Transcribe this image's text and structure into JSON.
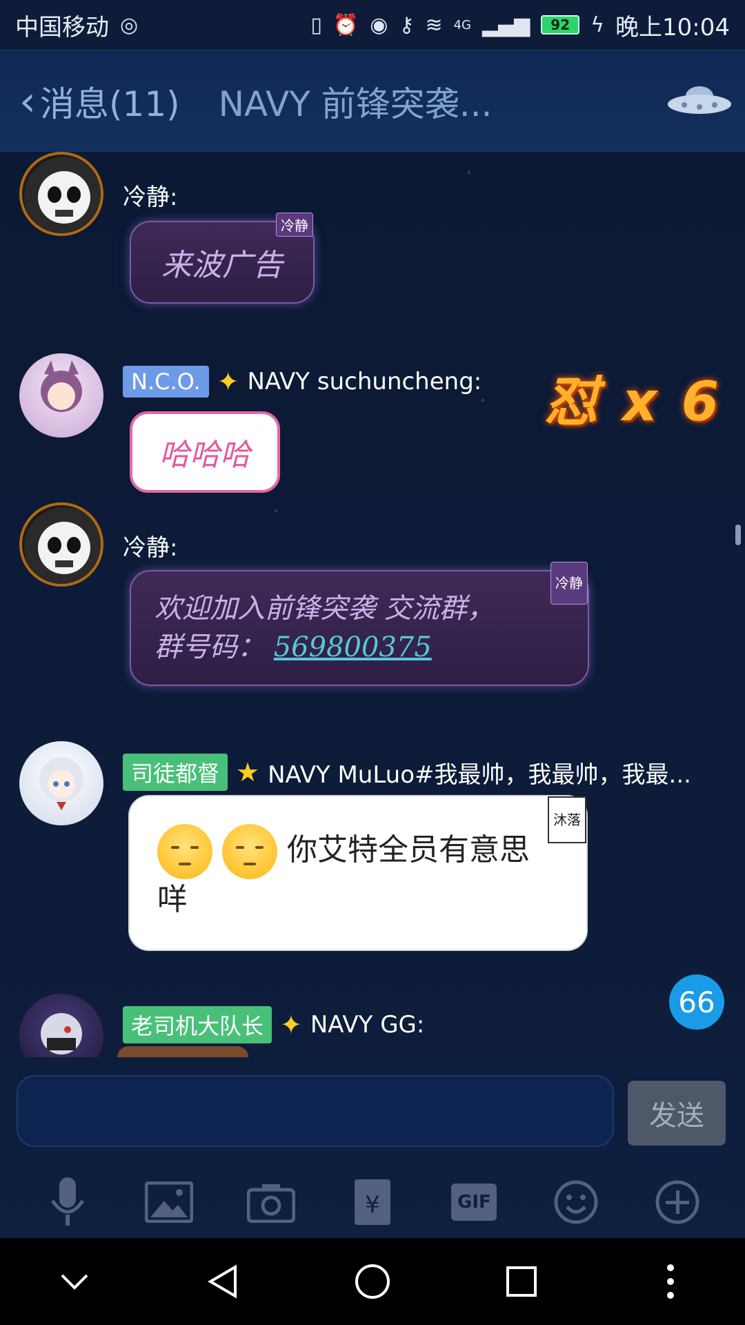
{
  "status_bar": {
    "carrier": "中国移动",
    "time": "晚上10:04",
    "battery": "92",
    "network": "4G"
  },
  "header": {
    "back_label": "消息(11)",
    "title": "NAVY 前锋突袭..."
  },
  "overlay": {
    "anger_label": "怼 x 6",
    "unread_badge": "66"
  },
  "messages": [
    {
      "sender": "冷静:",
      "bubble_tag": "冷静",
      "text": "来波广告"
    },
    {
      "title_tag": "N.C.O.",
      "sender": "NAVY suchuncheng:",
      "text": "哈哈哈"
    },
    {
      "sender": "冷静:",
      "bubble_tag": "冷静",
      "text_line1": "欢迎加入前锋突袭 交流群，",
      "text_line2_prefix": "群号码：",
      "link": "569800375"
    },
    {
      "title_tag": "司徒都督",
      "sender": "NAVY MuLuo#我最帅，我最帅，我最...",
      "bubble_tag": "沐落",
      "text_line1": "你艾特全员有意思",
      "text_line2": "咩"
    },
    {
      "title_tag": "老司机大队长",
      "sender": "NAVY GG:"
    }
  ],
  "input": {
    "send_label": "发送",
    "placeholder": ""
  },
  "colors": {
    "tag_blue": "#6d9be8",
    "tag_green": "#49c07a",
    "link": "#56c8d8"
  }
}
